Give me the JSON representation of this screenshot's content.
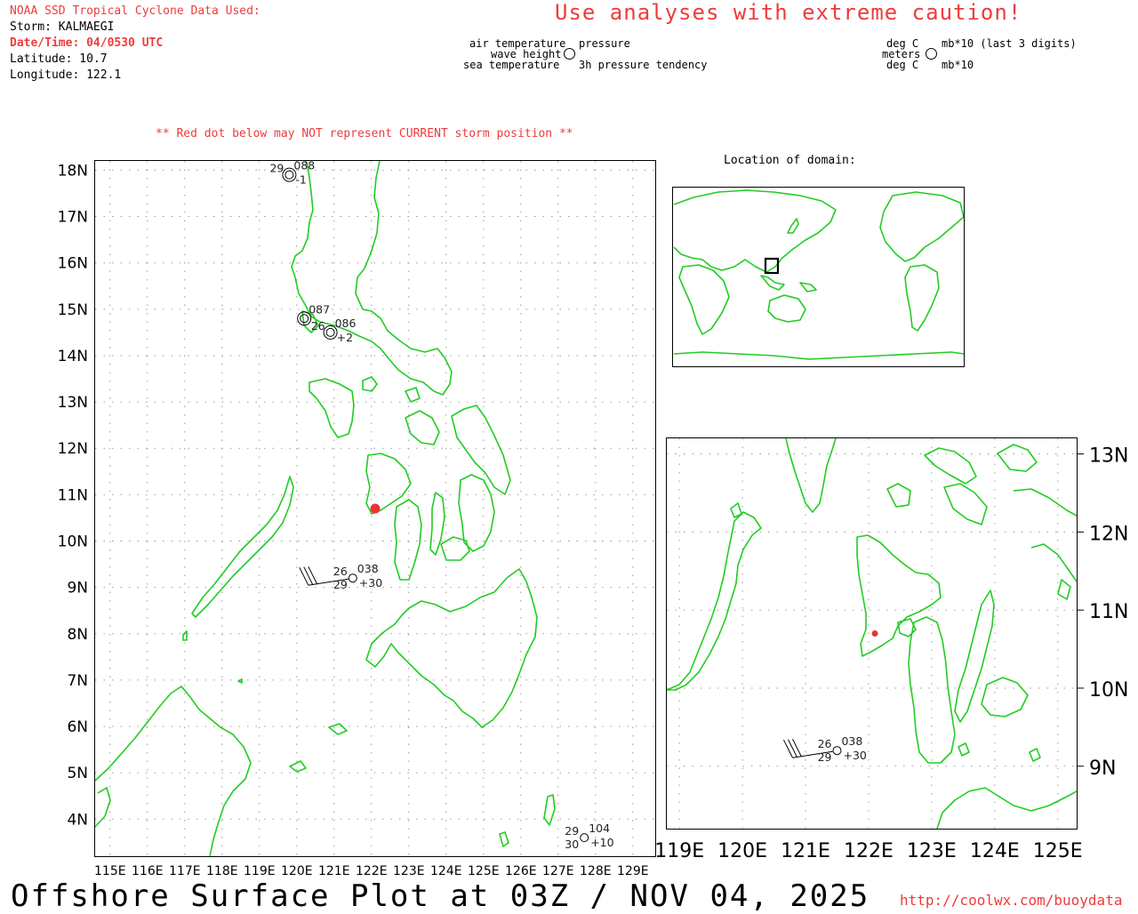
{
  "header": {
    "source": "NOAA SSD Tropical Cyclone Data Used:",
    "storm": "Storm: KALMAEGI",
    "datetime": "Date/Time: 04/0530 UTC",
    "latitude": "Latitude: 10.7",
    "longitude": "Longitude: 122.1",
    "caution": "Use analyses with extreme caution!"
  },
  "legend_left": {
    "air_temperature": "air temperature",
    "pressure": "pressure",
    "wave_height": "wave height",
    "sea_temperature": "sea temperature",
    "pressure_tendency": "3h pressure tendency"
  },
  "legend_right": {
    "deg_c_top": "deg C",
    "mb_last3": "mb*10 (last 3 digits)",
    "meters": "meters",
    "deg_c_bottom": "deg C",
    "mb10": "mb*10"
  },
  "warning": "** Red dot below may NOT represent CURRENT storm position **",
  "main_map": {
    "lat_labels": [
      "18N",
      "17N",
      "16N",
      "15N",
      "14N",
      "13N",
      "12N",
      "11N",
      "10N",
      "9N",
      "8N",
      "7N",
      "6N",
      "5N",
      "4N"
    ],
    "lon_labels": [
      "115E",
      "116E",
      "117E",
      "118E",
      "119E",
      "120E",
      "121E",
      "122E",
      "123E",
      "124E",
      "125E",
      "126E",
      "127E",
      "128E",
      "129E"
    ],
    "storm_position": {
      "lat": 10.7,
      "lon": 122.1
    }
  },
  "stations_main": [
    {
      "lat": 17.9,
      "lon": 119.8,
      "top_left": "29",
      "top_right": "088",
      "bottom_left": "",
      "bottom_right": "-1",
      "type": "circle-double"
    },
    {
      "lat": 14.8,
      "lon": 120.2,
      "top_left": "",
      "top_right": "087",
      "bottom_left": "",
      "bottom_right": "",
      "type": "circle-double"
    },
    {
      "lat": 14.5,
      "lon": 120.9,
      "top_left": "26",
      "top_right": "086",
      "bottom_left": "",
      "bottom_right": "+2",
      "type": "circle-double"
    },
    {
      "lat": 9.2,
      "lon": 121.5,
      "top_left": "26",
      "top_right": "038",
      "bottom_left": "29",
      "bottom_right": "+30",
      "type": "circle-barb"
    },
    {
      "lat": 3.6,
      "lon": 127.7,
      "top_left": "29",
      "top_right": "104",
      "bottom_left": "30",
      "bottom_right": "+10",
      "type": "circle"
    }
  ],
  "location_title": "Location of domain:",
  "zoom_map": {
    "lat_labels": [
      "13N",
      "12N",
      "11N",
      "10N",
      "9N"
    ],
    "lon_labels": [
      "119E",
      "120E",
      "121E",
      "122E",
      "123E",
      "124E",
      "125E"
    ]
  },
  "stations_zoom": [
    {
      "top_left": "26",
      "top_right": "038",
      "bottom_left": "29",
      "bottom_right": "+30"
    }
  ],
  "footer": {
    "title": "Offshore Surface Plot at 03Z / NOV 04, 2025",
    "url": "http://coolwx.com/buoydata"
  },
  "colors": {
    "coast": "#22cc22",
    "storm_dot": "#ee3333",
    "alert_text": "#ee3b3b",
    "grid": "#9a9a9a"
  }
}
